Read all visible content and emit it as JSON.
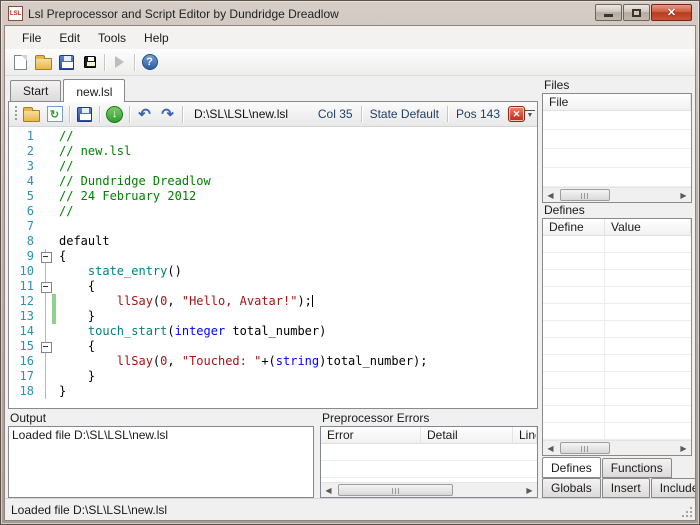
{
  "window": {
    "title": "Lsl Preprocessor and Script Editor by Dundridge Dreadlow",
    "icon_label": "LSL"
  },
  "menu": {
    "items": [
      "File",
      "Edit",
      "Tools",
      "Help"
    ]
  },
  "toolbar": {
    "icons": [
      "new-file",
      "open-file",
      "save",
      "save-black",
      "run-disabled",
      "help"
    ]
  },
  "doc_tabs": [
    {
      "label": "Start",
      "active": false
    },
    {
      "label": "new.lsl",
      "active": true
    }
  ],
  "editor": {
    "toolbar": {
      "icons": [
        "open-file",
        "reload",
        "save",
        "download",
        "undo",
        "redo",
        "close",
        "overflow"
      ],
      "path": "D:\\SL\\LSL\\new.lsl",
      "col": "Col 35",
      "state": "State Default",
      "pos": "Pos 143"
    },
    "code": {
      "lines": [
        {
          "n": 1,
          "tk": [
            [
              "cm",
              "//"
            ]
          ]
        },
        {
          "n": 2,
          "tk": [
            [
              "cm",
              "// new.lsl"
            ]
          ]
        },
        {
          "n": 3,
          "tk": [
            [
              "cm",
              "//"
            ]
          ]
        },
        {
          "n": 4,
          "tk": [
            [
              "cm",
              "// Dundridge Dreadlow"
            ]
          ]
        },
        {
          "n": 5,
          "tk": [
            [
              "cm",
              "// 24 February 2012"
            ]
          ]
        },
        {
          "n": 6,
          "tk": [
            [
              "cm",
              "//"
            ]
          ]
        },
        {
          "n": 7,
          "tk": []
        },
        {
          "n": 8,
          "tk": [
            [
              "pl",
              "default"
            ]
          ]
        },
        {
          "n": 9,
          "fold": "box",
          "tk": [
            [
              "pl",
              "{"
            ]
          ]
        },
        {
          "n": 10,
          "fold": "line",
          "tk": [
            [
              "pl",
              "    "
            ],
            [
              "fn",
              "state_entry"
            ],
            [
              "pl",
              "()"
            ]
          ]
        },
        {
          "n": 11,
          "fold": "box",
          "tk": [
            [
              "pl",
              "    {"
            ]
          ]
        },
        {
          "n": 12,
          "fold": "line",
          "changed": true,
          "cursor": true,
          "tk": [
            [
              "pl",
              "        "
            ],
            [
              "rd",
              "llSay"
            ],
            [
              "pl",
              "("
            ],
            [
              "rd",
              "0"
            ],
            [
              "pl",
              ", "
            ],
            [
              "st",
              "\"Hello, Avatar!\""
            ],
            [
              "pl",
              ");"
            ]
          ]
        },
        {
          "n": 13,
          "fold": "line",
          "changed": true,
          "tk": [
            [
              "pl",
              "    }"
            ]
          ]
        },
        {
          "n": 14,
          "fold": "line",
          "tk": [
            [
              "pl",
              "    "
            ],
            [
              "fn",
              "touch_start"
            ],
            [
              "pl",
              "("
            ],
            [
              "kw",
              "integer"
            ],
            [
              "pl",
              " total_number)"
            ]
          ]
        },
        {
          "n": 15,
          "fold": "box",
          "tk": [
            [
              "pl",
              "    {"
            ]
          ]
        },
        {
          "n": 16,
          "fold": "line",
          "tk": [
            [
              "pl",
              "        "
            ],
            [
              "rd",
              "llSay"
            ],
            [
              "pl",
              "("
            ],
            [
              "rd",
              "0"
            ],
            [
              "pl",
              ", "
            ],
            [
              "st",
              "\"Touched: \""
            ],
            [
              "pl",
              "+("
            ],
            [
              "kw",
              "string"
            ],
            [
              "pl",
              ")total_number);"
            ]
          ]
        },
        {
          "n": 17,
          "fold": "line",
          "tk": [
            [
              "pl",
              "    }"
            ]
          ]
        },
        {
          "n": 18,
          "fold": "line",
          "tk": [
            [
              "pl",
              "}"
            ]
          ]
        }
      ]
    }
  },
  "output_panel": {
    "title": "Output",
    "text": "Loaded file  D:\\SL\\LSL\\new.lsl"
  },
  "errors_panel": {
    "title": "Preprocessor Errors",
    "columns": [
      "Error",
      "Detail",
      "Line"
    ]
  },
  "sidebar": {
    "files": {
      "title": "Files",
      "columns": [
        "File"
      ]
    },
    "defines": {
      "title": "Defines",
      "columns": [
        "Define",
        "Value"
      ]
    },
    "tabs_row1": [
      {
        "label": "Defines",
        "active": true
      },
      {
        "label": "Functions",
        "active": false
      }
    ],
    "tabs_row2": [
      {
        "label": "Globals",
        "active": false
      },
      {
        "label": "Insert",
        "active": false
      },
      {
        "label": "Includes",
        "active": false
      }
    ]
  },
  "status_bar": {
    "text": "Loaded file D:\\SL\\LSL\\new.lsl"
  },
  "colors": {
    "comment": "#008000",
    "keyword": "#0000ff",
    "function": "#008080",
    "literal": "#a31515",
    "string": "#a31515",
    "line_number": "#2b91af",
    "close_button": "#c0281a",
    "change_bar": "#8fd18f"
  }
}
